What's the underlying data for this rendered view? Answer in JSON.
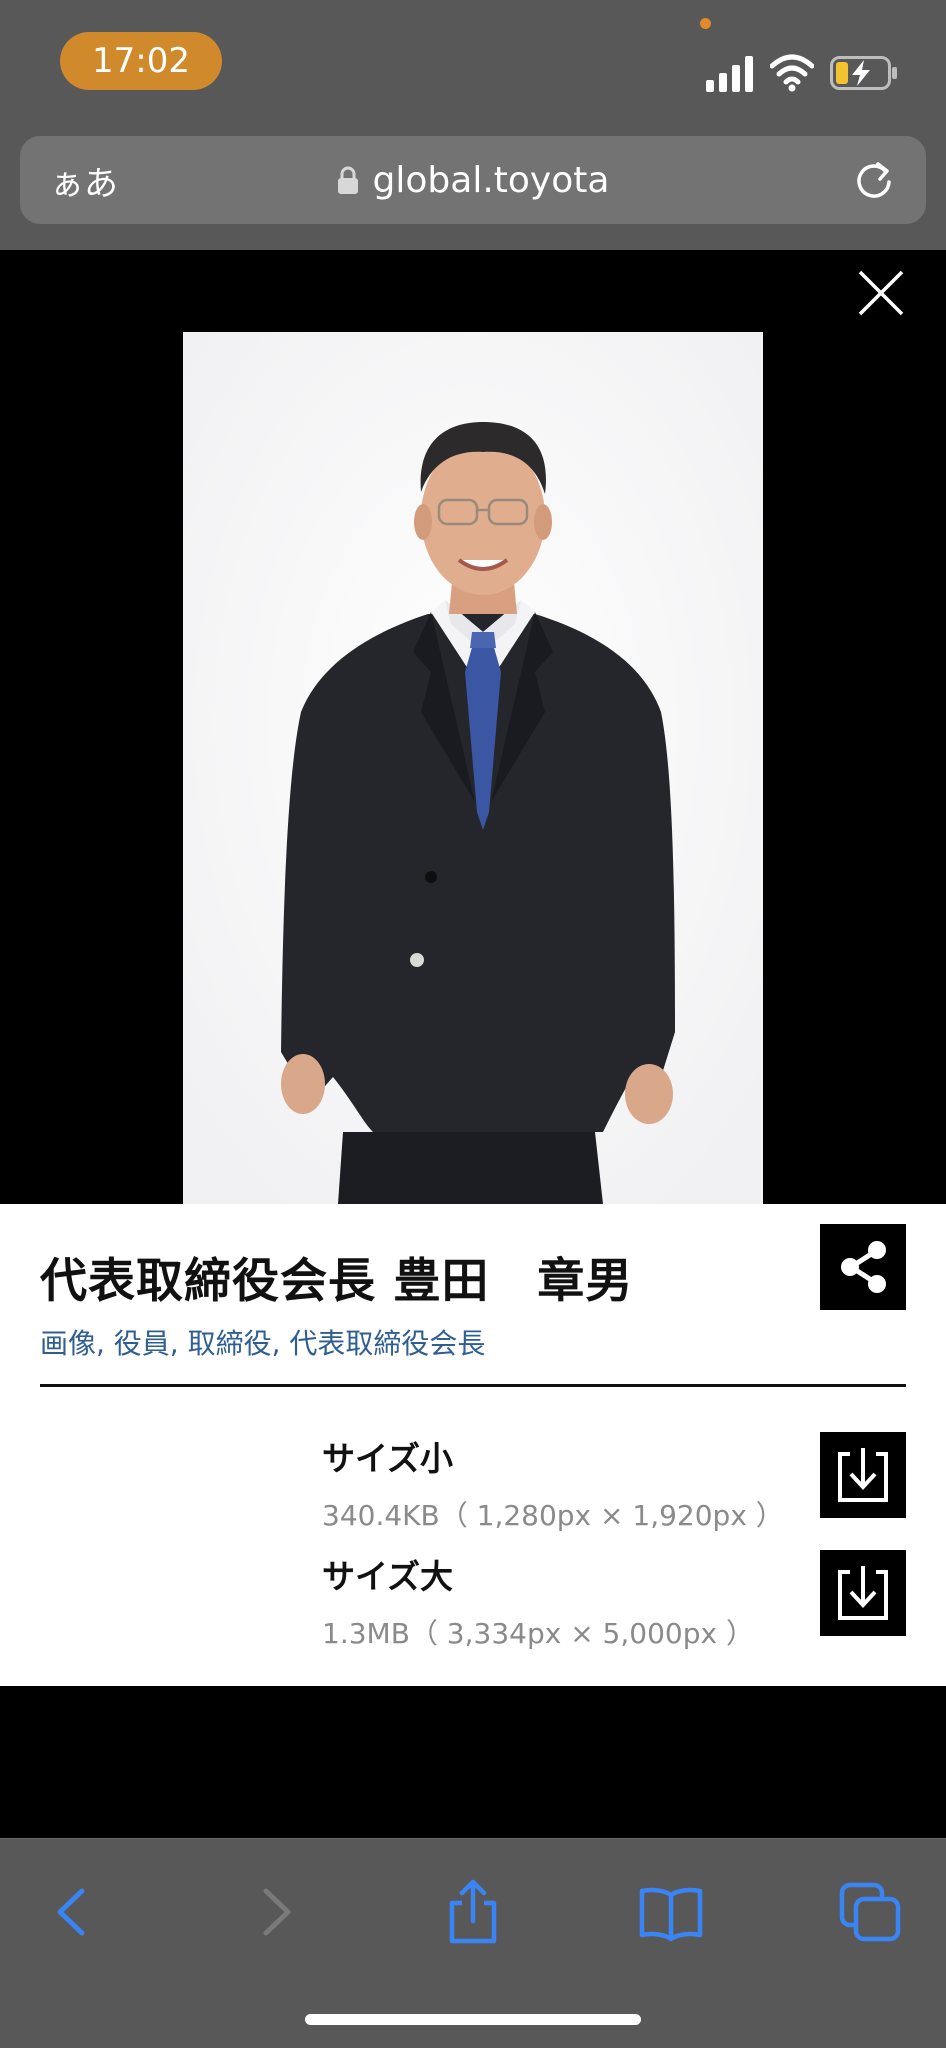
{
  "status_bar": {
    "time": "17:02"
  },
  "address_bar": {
    "aa_label": "ぁあ",
    "url": "global.toyota"
  },
  "image": {
    "description_icon": "portrait-photo"
  },
  "card": {
    "title": "代表取締役会長 豊田　章男",
    "tags": "画像, 役員, 取締役, 代表取締役会長",
    "downloads": [
      {
        "name": "サイズ小",
        "info": "340.4KB（ 1,280px × 1,920px ）"
      },
      {
        "name": "サイズ大",
        "info": "1.3MB（ 3,334px × 5,000px ）"
      }
    ]
  },
  "colors": {
    "chrome": "#585858",
    "time_pill": "#d18a2b",
    "tag_link": "#2f5e93",
    "toolbar_active": "#3a85f5",
    "toolbar_disabled": "#7a7a7a"
  },
  "toolbar": {
    "icons": [
      "back-icon",
      "forward-icon",
      "share-icon",
      "bookmarks-icon",
      "tabs-icon"
    ]
  }
}
